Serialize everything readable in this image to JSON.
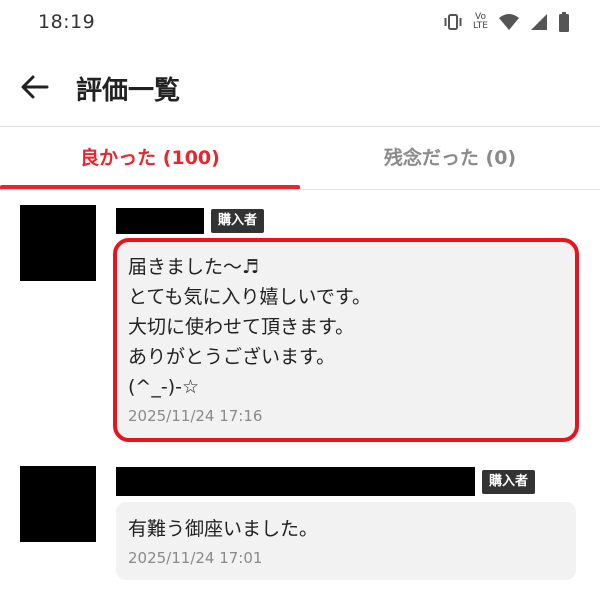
{
  "status_bar": {
    "time": "18:19",
    "volte_line1": "Vo",
    "volte_line2": "LTE",
    "icons": [
      "vibrate-icon",
      "volte-icon",
      "wifi-icon",
      "signal-icon",
      "battery-icon"
    ]
  },
  "app_bar": {
    "back_icon": "arrow-left-icon",
    "title": "評価一覧"
  },
  "tabs": [
    {
      "label": "良かった (100)",
      "active": true
    },
    {
      "label": "残念だった (0)",
      "active": false
    }
  ],
  "colors": {
    "accent": "#e8262e",
    "highlight": "#e6141e",
    "bubble": "#f2f2f2",
    "badge": "#333333"
  },
  "reviews": [
    {
      "badge": "購入者",
      "comment_lines": [
        "届きました〜♬",
        "とても気に入り嬉しいです。",
        "大切に使わせて頂きます。",
        "ありがとうございます。",
        "(^_-)-☆"
      ],
      "date": "2025/11/24 17:16",
      "highlighted": true
    },
    {
      "badge": "購入者",
      "comment_lines": [
        "有難う御座いました。"
      ],
      "date": "2025/11/24 17:01",
      "highlighted": false
    }
  ]
}
